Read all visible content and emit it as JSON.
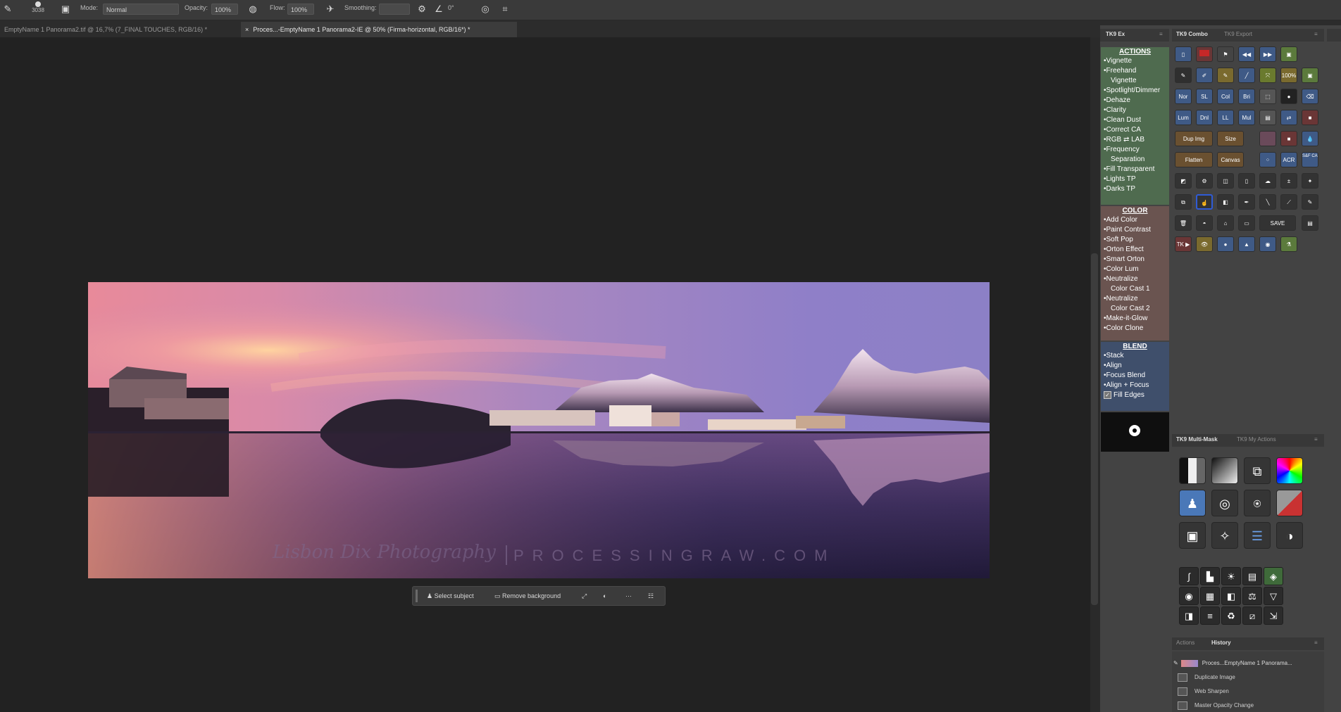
{
  "options_bar": {
    "brush_size": "3038",
    "mode_label": "Mode:",
    "mode_value": "Normal",
    "opacity_label": "Opacity:",
    "opacity_value": "100%",
    "flow_label": "Flow:",
    "flow_value": "100%",
    "smoothing_label": "Smoothing:",
    "angle_value": "0°"
  },
  "tabs": [
    {
      "label": "EmptyName 1 Panorama2.tif @ 16,7% (7_FINAL TOUCHES, RGB/16) *"
    },
    {
      "label": "Proces...-EmptyName 1 Panorama2-IE @ 50% (Firma-horizontal, RGB/16*) *"
    }
  ],
  "photo": {
    "watermark_script": "Lisbon Dix Photography",
    "watermark_caps": "PROCESSINGRAW.COM"
  },
  "contextual_taskbar": {
    "select_subject": "Select subject",
    "remove_background": "Remove background"
  },
  "panel_tabs": {
    "tk_ex": "TK9 Ex",
    "tk_combo": "TK9 Combo",
    "tk_export": "TK9 Export",
    "tk_multimask": "TK9 Multi-Mask",
    "tk_myactions": "TK9 My Actions",
    "actions": "Actions",
    "history": "History"
  },
  "actions_panel": {
    "actions_title": "ACTIONS",
    "actions_items": [
      {
        "label": "•Vignette",
        "sub": false
      },
      {
        "label": "•Freehand",
        "sub": false
      },
      {
        "label": "Vignette",
        "sub": true
      },
      {
        "label": "•Spotlight/Dimmer",
        "sub": false
      },
      {
        "label": "•Dehaze",
        "sub": false
      },
      {
        "label": "•Clarity",
        "sub": false
      },
      {
        "label": "•Clean Dust",
        "sub": false
      },
      {
        "label": "•Correct CA",
        "sub": false
      },
      {
        "label": "•RGB ⇄ LAB",
        "sub": false
      },
      {
        "label": "•Frequency",
        "sub": false
      },
      {
        "label": "Separation",
        "sub": true
      },
      {
        "label": "•Fill Transparent",
        "sub": false
      },
      {
        "label": "•Lights TP",
        "sub": false
      },
      {
        "label": "•Darks TP",
        "sub": false
      }
    ],
    "color_title": "COLOR",
    "color_items": [
      {
        "label": "•Add Color",
        "sub": false
      },
      {
        "label": "•Paint Contrast",
        "sub": false
      },
      {
        "label": "•Soft Pop",
        "sub": false
      },
      {
        "label": "•Orton Effect",
        "sub": false
      },
      {
        "label": "•Smart Orton",
        "sub": false
      },
      {
        "label": "•Color Lum",
        "sub": false
      },
      {
        "label": "•Neutralize",
        "sub": false
      },
      {
        "label": "Color Cast 1",
        "sub": true
      },
      {
        "label": "•Neutralize",
        "sub": false
      },
      {
        "label": "Color Cast 2",
        "sub": true
      },
      {
        "label": "•Make-it-Glow",
        "sub": false
      },
      {
        "label": "•Color Clone",
        "sub": false
      }
    ],
    "blend_title": "BLEND",
    "blend_items": [
      {
        "label": "•Stack",
        "sub": false
      },
      {
        "label": "•Align",
        "sub": false
      },
      {
        "label": "•Focus Blend",
        "sub": false
      },
      {
        "label": "•Align + Focus",
        "sub": false
      }
    ],
    "fill_edges": "Fill Edges"
  },
  "combo_buttons": {
    "row3": [
      "Nor",
      "SL",
      "Col",
      "Bri"
    ],
    "row4": [
      "Lum",
      "Dnl",
      "LL",
      "Mul"
    ],
    "dup_img": "Dup Img",
    "size": "Size",
    "flatten": "Flatten",
    "canvas": "Canvas",
    "pct100": "100%",
    "acr": "ACR",
    "sbs": "S&F CAF",
    "tk": "TK ▶",
    "save": "SAVE"
  },
  "history": {
    "snapshot": "Proces...EmptyName 1 Panorama...",
    "items": [
      "Duplicate Image",
      "Web Sharpen",
      "Master Opacity Change"
    ]
  },
  "colors": {
    "actions_bg": "#4f6b4f",
    "color_bg": "#6a5450",
    "blend_bg": "#3f4f6b"
  }
}
